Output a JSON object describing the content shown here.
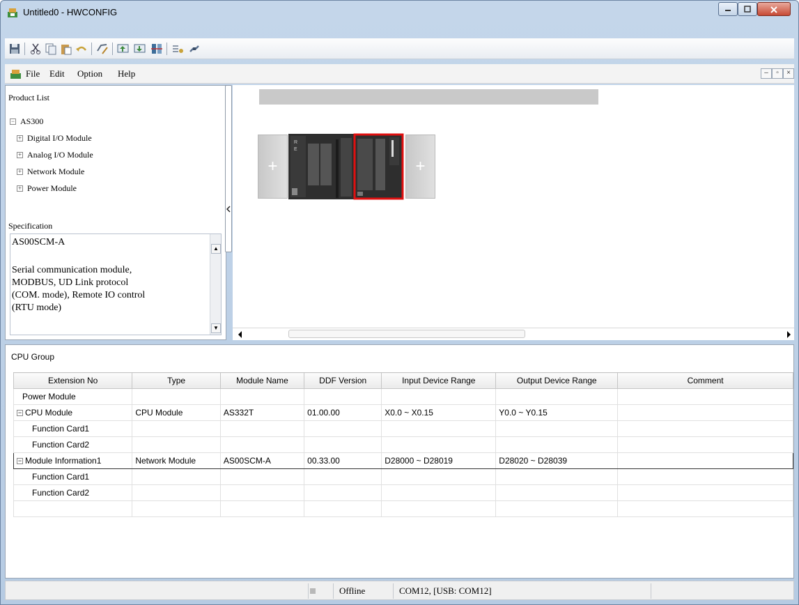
{
  "window": {
    "title": "Untitled0 - HWCONFIG"
  },
  "menu": {
    "items": [
      "File",
      "Edit",
      "Option",
      "Help"
    ]
  },
  "toolbar": {
    "icons": [
      "save-icon",
      "cut-icon",
      "copy-icon",
      "paste-icon",
      "undo-icon",
      "check-icon",
      "upload-icon",
      "download-icon",
      "scan-icon",
      "online-icon",
      "connect-icon"
    ]
  },
  "product_list": {
    "label": "Product List",
    "root": "AS300",
    "items": [
      "Digital I/O Module",
      "Analog I/O Module",
      "Network Module",
      "Power Module"
    ]
  },
  "specification": {
    "label": "Specification",
    "model": "AS00SCM-A",
    "description_lines": [
      "Serial communication module,",
      "MODBUS, UD Link protocol",
      "(COM. mode), Remote IO control",
      "(RTU mode)"
    ]
  },
  "cpu_group": {
    "title": "CPU Group",
    "columns": [
      "Extension No",
      "Type",
      "Module Name",
      "DDF Version",
      "Input Device Range",
      "Output Device Range",
      "Comment"
    ],
    "rows": [
      [
        "Power Module",
        "",
        "",
        "",
        "",
        "",
        ""
      ],
      [
        "CPU Module",
        "CPU Module",
        "AS332T",
        "01.00.00",
        "X0.0 ~ X0.15",
        "Y0.0 ~ Y0.15",
        ""
      ],
      [
        "Function Card1",
        "",
        "",
        "",
        "",
        "",
        ""
      ],
      [
        "Function Card2",
        "",
        "",
        "",
        "",
        "",
        ""
      ],
      [
        "Module Information1",
        "Network Module",
        "AS00SCM-A",
        "00.33.00",
        "D28000 ~ D28019",
        "D28020 ~ D28039",
        ""
      ],
      [
        "Function Card1",
        "",
        "",
        "",
        "",
        "",
        ""
      ],
      [
        "Function Card2",
        "",
        "",
        "",
        "",
        "",
        ""
      ],
      [
        "",
        "",
        "",
        "",
        "",
        "",
        ""
      ]
    ]
  },
  "status": {
    "mode": "Offline",
    "port": "COM12, [USB: COM12]"
  }
}
